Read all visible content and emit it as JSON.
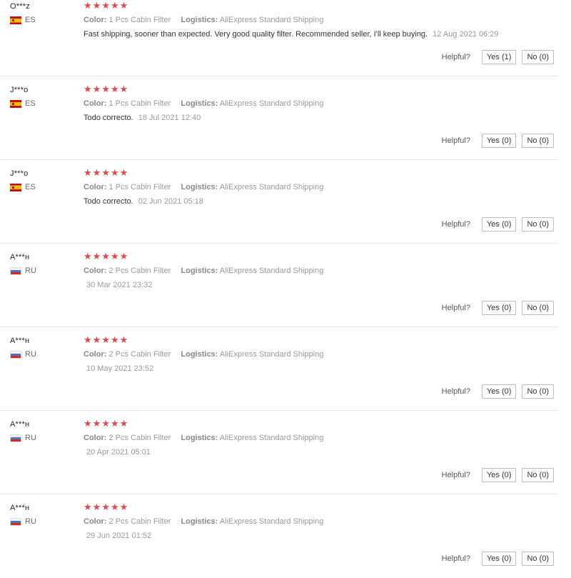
{
  "labels": {
    "color": "Color:",
    "logistics": "Logistics:",
    "helpful": "Helpful?"
  },
  "theme": {
    "star_color": "#e0484b"
  },
  "reviews": [
    {
      "name": "O***z",
      "country": "ES",
      "flag": "es",
      "stars": 5,
      "color": "1 Pcs Cabin Filter",
      "logistics": "AliExpress Standard Shipping",
      "text": "Fast shipping, sooner than expected. Very good quality filter. Recommended seller, I'll keep buying.",
      "date": "12 Aug 2021 06:29",
      "yes": "Yes (1)",
      "no": "No (0)"
    },
    {
      "name": "J***o",
      "country": "ES",
      "flag": "es",
      "stars": 5,
      "color": "1 Pcs Cabin Filter",
      "logistics": "AliExpress Standard Shipping",
      "text": "Todo correcto.",
      "date": "18 Jul 2021 12:40",
      "yes": "Yes (0)",
      "no": "No (0)"
    },
    {
      "name": "J***o",
      "country": "ES",
      "flag": "es",
      "stars": 5,
      "color": "1 Pcs Cabin Filter",
      "logistics": "AliExpress Standard Shipping",
      "text": "Todo correcto.",
      "date": "02 Jun 2021 05:18",
      "yes": "Yes (0)",
      "no": "No (0)"
    },
    {
      "name": "A***н",
      "country": "RU",
      "flag": "ru",
      "stars": 5,
      "color": "2 Pcs Cabin Filter",
      "logistics": "AliExpress Standard Shipping",
      "text": "",
      "date": "30 Mar 2021 23:32",
      "yes": "Yes (0)",
      "no": "No (0)"
    },
    {
      "name": "A***н",
      "country": "RU",
      "flag": "ru",
      "stars": 5,
      "color": "2 Pcs Cabin Filter",
      "logistics": "AliExpress Standard Shipping",
      "text": "",
      "date": "10 May 2021 23:52",
      "yes": "Yes (0)",
      "no": "No (0)"
    },
    {
      "name": "A***н",
      "country": "RU",
      "flag": "ru",
      "stars": 5,
      "color": "2 Pcs Cabin Filter",
      "logistics": "AliExpress Standard Shipping",
      "text": "",
      "date": "20 Apr 2021 05:01",
      "yes": "Yes (0)",
      "no": "No (0)"
    },
    {
      "name": "A***н",
      "country": "RU",
      "flag": "ru",
      "stars": 5,
      "color": "2 Pcs Cabin Filter",
      "logistics": "AliExpress Standard Shipping",
      "text": "",
      "date": "29 Jun 2021 01:52",
      "yes": "Yes (0)",
      "no": "No (0)"
    }
  ]
}
